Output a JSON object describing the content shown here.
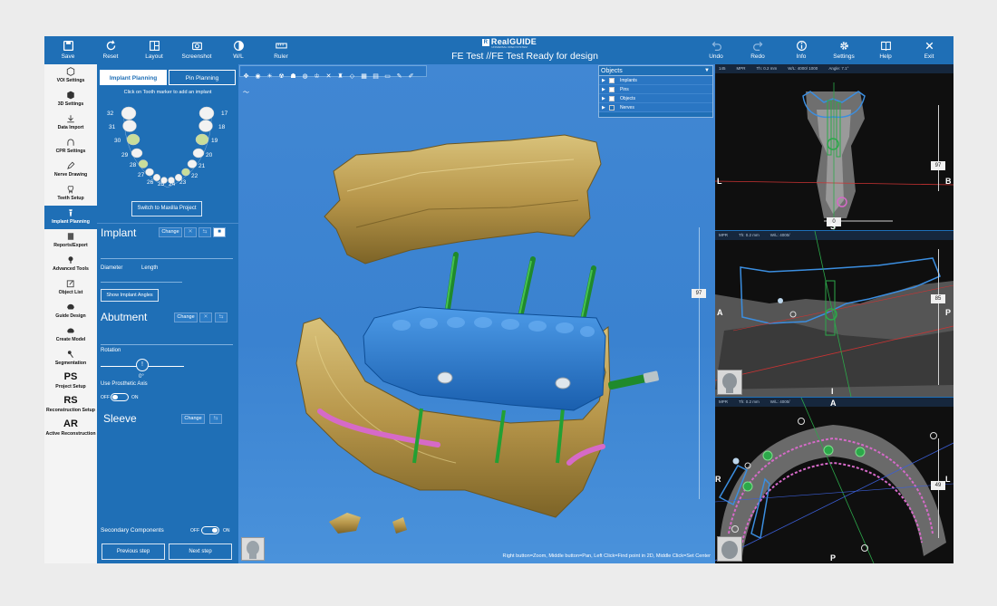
{
  "app": {
    "title": "FE Test //FE Test Ready for design",
    "logo": "RealGUIDE",
    "logo_sub": "UNIVERSAL OPEN SYSTEM"
  },
  "toolbar": {
    "left": [
      {
        "label": "Save",
        "icon": "save-icon"
      },
      {
        "label": "Reset",
        "icon": "reset-icon"
      },
      {
        "label": "Layout",
        "icon": "layout-icon"
      },
      {
        "label": "Screenshot",
        "icon": "camera-icon"
      },
      {
        "label": "W/L",
        "icon": "contrast-icon"
      },
      {
        "label": "Ruler",
        "icon": "ruler-icon"
      }
    ],
    "right": [
      {
        "label": "Undo",
        "icon": "undo-icon"
      },
      {
        "label": "Redo",
        "icon": "redo-icon"
      },
      {
        "label": "Info",
        "icon": "info-icon"
      },
      {
        "label": "Settings",
        "icon": "gear-icon"
      },
      {
        "label": "Help",
        "icon": "book-icon"
      },
      {
        "label": "Exit",
        "icon": "close-icon"
      }
    ]
  },
  "sidebar": {
    "items": [
      {
        "label": "VOI Settings",
        "icon": "cube-icon"
      },
      {
        "label": "3D Settings",
        "icon": "cube-3d-icon"
      },
      {
        "label": "Data Import",
        "icon": "download-icon"
      },
      {
        "label": "CPR Settings",
        "icon": "arch-icon"
      },
      {
        "label": "Nerve Drawing",
        "icon": "pen-icon"
      },
      {
        "label": "Teeth Setup",
        "icon": "tooth-icon"
      },
      {
        "label": "Implant Planning",
        "icon": "implant-icon",
        "active": true
      },
      {
        "label": "Reports/Export",
        "icon": "report-icon"
      },
      {
        "label": "Advanced Tools",
        "icon": "tools-icon"
      },
      {
        "label": "Object List",
        "icon": "list-icon"
      },
      {
        "label": "Guide Design",
        "icon": "guide-icon"
      },
      {
        "label": "Create Model",
        "icon": "model-icon"
      },
      {
        "label": "Segmentation",
        "icon": "segmentation-icon"
      },
      {
        "label": "Project Setup",
        "glyph": "PS"
      },
      {
        "label": "Reconstruction Setup",
        "glyph": "RS"
      },
      {
        "label": "Active Reconstruction",
        "glyph": "AR"
      }
    ]
  },
  "panel": {
    "tab_implant": "Implant Planning",
    "tab_pin": "Pin Planning",
    "hint": "Click on Tooth marker to add an implant",
    "tooth_numbers": [
      "32",
      "31",
      "30",
      "29",
      "28",
      "27",
      "26",
      "25",
      "24",
      "23",
      "22",
      "21",
      "20",
      "19",
      "18",
      "17"
    ],
    "switch_button": "Switch to Maxilla Project",
    "implant": {
      "title": "Implant",
      "change": "Change",
      "diameter": "Diameter",
      "length": "Length",
      "show_angles": "Show Implant Angles"
    },
    "abutment": {
      "title": "Abutment",
      "change": "Change",
      "rotation": "Rotation",
      "rotation_value": "0°",
      "use_prosthetic_axis": "Use Prosthetic Axis",
      "off": "OFF",
      "on": "ON"
    },
    "sleeve": {
      "title": "Sleeve",
      "change": "Change"
    },
    "secondary": {
      "label": "Secondary Components",
      "off": "OFF",
      "on": "ON"
    },
    "prev_step": "Previous step",
    "next_step": "Next step"
  },
  "view3d": {
    "objects_title": "Objects",
    "objects": [
      "Implants",
      "Pins",
      "Objects",
      "Nerves"
    ],
    "zoom_value": "97",
    "status": "Right button=Zoom, Middle button=Pan, Left Click=Find point in 2D, Middle Click=Set Center"
  },
  "slices": [
    {
      "header": [
        "145",
        "MPR",
        "Th: 0.2 mm",
        "W/L: 4000/ 1000",
        "Angle: 7.1°"
      ],
      "left": "L",
      "right": "B",
      "bottom": "S",
      "value": "97",
      "h_value": "0"
    },
    {
      "header": [
        "MPR",
        "Th: 0.2 mm",
        "W/L: 4000/"
      ],
      "left": "A",
      "right": "P",
      "bottom": "I",
      "value": "85"
    },
    {
      "header": [
        "MPR",
        "Th: 0.2 mm",
        "W/L: 4000/"
      ],
      "top": "A",
      "left": "R",
      "right": "L",
      "bottom": "P",
      "value": "49"
    }
  ],
  "colors": {
    "accent": "#1f6fb6",
    "bone": "#c8a85a",
    "guide": "#2e7fd0",
    "implant": "#22a033",
    "nerve": "#d66ac8"
  }
}
